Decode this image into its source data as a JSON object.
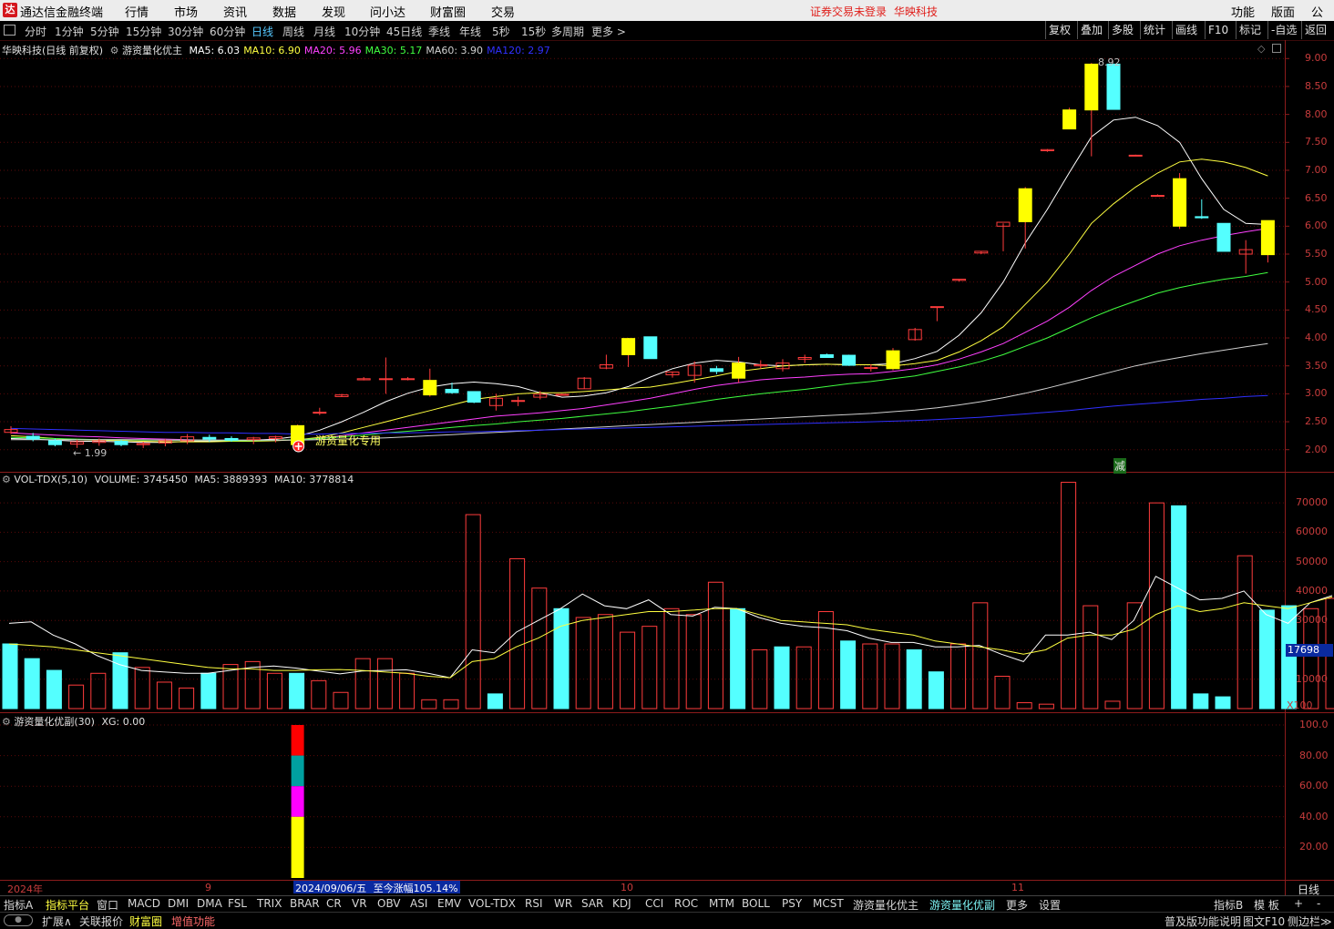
{
  "titlebar": {
    "logo": "达",
    "app_title": "通达信金融终端",
    "menu": [
      "行情",
      "市场",
      "资讯",
      "数据",
      "发现",
      "问小达",
      "财富圈",
      "交易"
    ],
    "login_warning": "证券交易未登录",
    "stock_name": "华映科技",
    "right_menu": [
      "功能",
      "版面",
      "公式"
    ]
  },
  "toolbar": {
    "periods": [
      "分时",
      "1分钟",
      "5分钟",
      "15分钟",
      "30分钟",
      "60分钟",
      "日线",
      "周线",
      "月线",
      "10分钟",
      "45日线",
      "季线",
      "年线",
      "5秒",
      "15秒",
      "多周期",
      "更多 >"
    ],
    "active_period": "日线",
    "right_buttons": [
      "复权",
      "叠加",
      "多股",
      "统计",
      "画线",
      "F10",
      "标记",
      "-自选",
      "返回"
    ]
  },
  "main_pane": {
    "stock_label": "华映科技(日线 前复权)",
    "indicator": "游资量化优主",
    "ma": [
      {
        "label": "MA5: 6.03",
        "color": "#ffffff"
      },
      {
        "label": "MA10: 6.90",
        "color": "#ffff40"
      },
      {
        "label": "MA20: 5.96",
        "color": "#ff40ff"
      },
      {
        "label": "MA30: 5.17",
        "color": "#40ff40"
      },
      {
        "label": "MA60: 3.90",
        "color": "#d0d0d0"
      },
      {
        "label": "MA120: 2.97",
        "color": "#3030ff"
      }
    ],
    "y_labels": [
      "9.00",
      "8.50",
      "8.00",
      "7.50",
      "7.00",
      "6.50",
      "6.00",
      "5.50",
      "5.00",
      "4.50",
      "4.00",
      "3.50",
      "3.00",
      "2.50",
      "2.00"
    ],
    "low_marker": "← 1.99",
    "high_marker": "8.92",
    "signal_text": "游资量化专用",
    "reduce_text": "减"
  },
  "vol_pane": {
    "header": "VOL-TDX(5,10)",
    "volume": "VOLUME: 3745450",
    "ma5": "MA5: 3889393",
    "ma10": "MA10: 3778814",
    "y_labels": [
      "70000",
      "60000",
      "50000",
      "40000",
      "30000",
      "20000",
      "10000"
    ],
    "cursor_value": "17698",
    "multiplier": "X100"
  },
  "ind_pane": {
    "header": "游资量化优副(30)",
    "xg": "XG: 0.00",
    "y_labels": [
      "100.0",
      "80.00",
      "60.00",
      "40.00",
      "20.00"
    ]
  },
  "axis": {
    "labels": [
      "2024年",
      "9",
      "10",
      "11"
    ],
    "cursor_date": "2024/09/06/五",
    "cursor_gain": "至今涨幅105.14%",
    "period_label": "日线"
  },
  "bottom_tabs": [
    "指标A",
    "指标平台",
    "窗口",
    "MACD",
    "DMI",
    "DMA",
    "FSL",
    "TRIX",
    "BRAR",
    "CR",
    "VR",
    "OBV",
    "ASI",
    "EMV",
    "VOL-TDX",
    "RSI",
    "WR",
    "SAR",
    "KDJ",
    "CCI",
    "ROC",
    "MTM",
    "BOLL",
    "PSY",
    "MCST",
    "游资量化优主",
    "游资量化优副",
    "更多",
    "设置"
  ],
  "bottom_right": [
    "指标B",
    "模 板",
    "+",
    "-"
  ],
  "status": {
    "left": [
      "扩展∧",
      "关联报价",
      "财富圈",
      "增值功能"
    ],
    "right": [
      "普及版功能说明",
      "图文F10",
      "侧边栏≫"
    ]
  },
  "colors": {
    "up": "#ff3c3c",
    "up_fill": "#ffff00",
    "down": "#54ffff",
    "axis": "#8c1c1c"
  },
  "chart_data": [
    {
      "type": "candlestick",
      "title": "华映科技(日线 前复权)",
      "ylim": [
        1.8,
        9.2
      ],
      "candles": [
        [
          2.31,
          2.42,
          2.28,
          2.36
        ],
        [
          2.24,
          2.3,
          2.15,
          2.19
        ],
        [
          2.16,
          2.2,
          2.06,
          2.09
        ],
        [
          2.1,
          2.18,
          2.03,
          2.14
        ],
        [
          2.13,
          2.2,
          2.07,
          2.16
        ],
        [
          2.15,
          2.18,
          2.06,
          2.09
        ],
        [
          2.09,
          2.14,
          2.03,
          2.11
        ],
        [
          2.12,
          2.19,
          2.06,
          2.16
        ],
        [
          2.16,
          2.28,
          2.1,
          2.23
        ],
        [
          2.22,
          2.27,
          2.14,
          2.19
        ],
        [
          2.2,
          2.24,
          2.14,
          2.17
        ],
        [
          2.18,
          2.23,
          2.1,
          2.21
        ],
        [
          2.2,
          2.25,
          2.13,
          2.23
        ],
        [
          2.09,
          2.45,
          2.06,
          2.43
        ],
        [
          2.67,
          2.75,
          2.62,
          2.67
        ],
        [
          2.95,
          3.0,
          2.94,
          2.98
        ],
        [
          3.25,
          3.3,
          3.24,
          3.27
        ],
        [
          3.27,
          3.65,
          3.0,
          3.27
        ],
        [
          3.27,
          3.3,
          3.24,
          3.27
        ],
        [
          2.98,
          3.45,
          2.95,
          3.24
        ],
        [
          3.08,
          3.2,
          3.0,
          3.02
        ],
        [
          3.04,
          2.84,
          2.83,
          2.85
        ],
        [
          2.79,
          3.0,
          2.7,
          2.92
        ],
        [
          2.87,
          2.95,
          2.78,
          2.88
        ],
        [
          2.94,
          3.05,
          2.9,
          2.99
        ],
        [
          2.98,
          3.0,
          2.97,
          2.99
        ],
        [
          3.09,
          3.3,
          3.09,
          3.28
        ],
        [
          3.46,
          3.7,
          3.44,
          3.52
        ],
        [
          3.7,
          4.0,
          3.48,
          3.99
        ],
        [
          4.02,
          4.02,
          3.63,
          3.63
        ],
        [
          3.34,
          3.4,
          3.29,
          3.39
        ],
        [
          3.33,
          3.58,
          3.2,
          3.51
        ],
        [
          3.45,
          3.5,
          3.35,
          3.4
        ],
        [
          3.28,
          3.66,
          3.2,
          3.55
        ],
        [
          3.5,
          3.6,
          3.45,
          3.52
        ],
        [
          3.45,
          3.62,
          3.4,
          3.55
        ],
        [
          3.62,
          3.7,
          3.55,
          3.65
        ],
        [
          3.7,
          3.72,
          3.65,
          3.65
        ],
        [
          3.69,
          3.7,
          3.5,
          3.51
        ],
        [
          3.47,
          3.53,
          3.4,
          3.47
        ],
        [
          3.45,
          3.82,
          3.42,
          3.77
        ],
        [
          3.97,
          4.18,
          3.95,
          4.15
        ],
        [
          4.55,
          4.55,
          4.3,
          4.56
        ],
        [
          5.03,
          5.05,
          5.01,
          5.05
        ],
        [
          5.52,
          5.55,
          5.5,
          5.55
        ],
        [
          6.0,
          6.05,
          5.55,
          6.07
        ],
        [
          6.08,
          6.7,
          5.6,
          6.67
        ],
        [
          7.35,
          7.38,
          7.33,
          7.37
        ],
        [
          7.74,
          8.12,
          7.74,
          8.08
        ],
        [
          8.08,
          8.92,
          7.25,
          8.9
        ],
        [
          8.9,
          8.9,
          8.09,
          8.09
        ],
        [
          7.27,
          7.28,
          7.26,
          7.27
        ],
        [
          6.55,
          6.57,
          6.53,
          6.55
        ],
        [
          6.0,
          6.95,
          5.95,
          6.85
        ],
        [
          6.17,
          6.48,
          6.13,
          6.15
        ],
        [
          6.05,
          6.05,
          5.55,
          5.55
        ],
        [
          5.5,
          5.75,
          5.15,
          5.58
        ],
        [
          5.49,
          6.1,
          5.35,
          6.1
        ]
      ],
      "ma_series": [
        {
          "name": "MA5",
          "values": [
            2.2,
            2.19,
            2.17,
            2.15,
            2.15,
            2.14,
            2.13,
            2.13,
            2.15,
            2.15,
            2.16,
            2.17,
            2.19,
            2.24,
            2.35,
            2.5,
            2.67,
            2.86,
            3.01,
            3.12,
            3.18,
            3.21,
            3.18,
            3.13,
            3.02,
            2.94,
            2.96,
            3.02,
            3.13,
            3.3,
            3.45,
            3.55,
            3.6,
            3.57,
            3.52,
            3.5,
            3.52,
            3.53,
            3.52,
            3.52,
            3.54,
            3.63,
            3.76,
            4.05,
            4.45,
            5.0,
            5.7,
            6.3,
            6.96,
            7.6,
            7.9,
            7.95,
            7.8,
            7.5,
            6.85,
            6.3,
            6.05,
            6.03
          ]
        },
        {
          "name": "MA10",
          "values": [
            2.25,
            2.23,
            2.2,
            2.18,
            2.17,
            2.16,
            2.15,
            2.14,
            2.14,
            2.14,
            2.15,
            2.15,
            2.16,
            2.18,
            2.22,
            2.3,
            2.4,
            2.5,
            2.6,
            2.7,
            2.8,
            2.9,
            2.95,
            3.0,
            3.02,
            3.02,
            3.04,
            3.07,
            3.1,
            3.12,
            3.18,
            3.25,
            3.32,
            3.4,
            3.45,
            3.5,
            3.52,
            3.53,
            3.52,
            3.52,
            3.5,
            3.54,
            3.6,
            3.75,
            3.95,
            4.2,
            4.6,
            5.0,
            5.5,
            6.05,
            6.4,
            6.7,
            6.95,
            7.15,
            7.2,
            7.15,
            7.05,
            6.9
          ]
        },
        {
          "name": "MA20",
          "values": [
            2.3,
            2.28,
            2.26,
            2.24,
            2.23,
            2.21,
            2.2,
            2.19,
            2.18,
            2.17,
            2.17,
            2.17,
            2.17,
            2.18,
            2.2,
            2.25,
            2.3,
            2.35,
            2.4,
            2.45,
            2.5,
            2.55,
            2.6,
            2.63,
            2.66,
            2.7,
            2.74,
            2.8,
            2.86,
            2.92,
            3.0,
            3.08,
            3.15,
            3.2,
            3.25,
            3.28,
            3.3,
            3.33,
            3.35,
            3.36,
            3.4,
            3.45,
            3.52,
            3.62,
            3.75,
            3.9,
            4.1,
            4.3,
            4.55,
            4.85,
            5.1,
            5.3,
            5.5,
            5.65,
            5.75,
            5.83,
            5.9,
            5.96
          ]
        },
        {
          "name": "MA30",
          "values": [
            2.22,
            2.21,
            2.2,
            2.19,
            2.18,
            2.18,
            2.17,
            2.17,
            2.17,
            2.17,
            2.16,
            2.16,
            2.17,
            2.18,
            2.2,
            2.23,
            2.26,
            2.3,
            2.33,
            2.36,
            2.4,
            2.43,
            2.46,
            2.5,
            2.53,
            2.56,
            2.6,
            2.64,
            2.68,
            2.73,
            2.78,
            2.84,
            2.9,
            2.95,
            3.0,
            3.04,
            3.08,
            3.13,
            3.18,
            3.22,
            3.27,
            3.32,
            3.4,
            3.48,
            3.58,
            3.7,
            3.85,
            4.0,
            4.18,
            4.36,
            4.52,
            4.66,
            4.8,
            4.9,
            4.98,
            5.05,
            5.1,
            5.17
          ]
        },
        {
          "name": "MA60",
          "values": [
            2.18,
            2.18,
            2.18,
            2.18,
            2.18,
            2.18,
            2.18,
            2.17,
            2.17,
            2.17,
            2.17,
            2.17,
            2.17,
            2.17,
            2.18,
            2.19,
            2.2,
            2.21,
            2.23,
            2.25,
            2.27,
            2.29,
            2.31,
            2.33,
            2.35,
            2.37,
            2.39,
            2.41,
            2.43,
            2.45,
            2.47,
            2.49,
            2.51,
            2.53,
            2.55,
            2.57,
            2.59,
            2.61,
            2.63,
            2.65,
            2.68,
            2.71,
            2.75,
            2.8,
            2.86,
            2.93,
            3.01,
            3.1,
            3.2,
            3.3,
            3.4,
            3.5,
            3.58,
            3.65,
            3.72,
            3.78,
            3.84,
            3.9
          ]
        },
        {
          "name": "MA120",
          "values": [
            2.38,
            2.37,
            2.36,
            2.35,
            2.34,
            2.33,
            2.32,
            2.31,
            2.31,
            2.3,
            2.3,
            2.29,
            2.29,
            2.28,
            2.28,
            2.29,
            2.29,
            2.3,
            2.3,
            2.31,
            2.32,
            2.32,
            2.33,
            2.34,
            2.35,
            2.36,
            2.37,
            2.38,
            2.39,
            2.4,
            2.41,
            2.42,
            2.43,
            2.44,
            2.45,
            2.46,
            2.47,
            2.48,
            2.49,
            2.5,
            2.51,
            2.52,
            2.54,
            2.56,
            2.58,
            2.61,
            2.64,
            2.67,
            2.7,
            2.74,
            2.78,
            2.81,
            2.84,
            2.87,
            2.9,
            2.92,
            2.95,
            2.97
          ]
        }
      ]
    },
    {
      "type": "bar",
      "title": "VOL-TDX(5,10)",
      "ylim": [
        0,
        75000
      ],
      "values": [
        22000,
        17000,
        13000,
        8000,
        12000,
        19000,
        14000,
        9000,
        7000,
        12000,
        15000,
        16000,
        12000,
        12000,
        9500,
        5500,
        17000,
        17000,
        12000,
        3000,
        3000,
        66000,
        5000,
        51000,
        41000,
        34000,
        31000,
        32000,
        26000,
        28000,
        34000,
        32000,
        43000,
        34000,
        20000,
        21000,
        21000,
        33000,
        23000,
        22000,
        22000,
        20000,
        12500,
        22000,
        36000,
        11000,
        2000,
        1500,
        77000,
        35000,
        2500,
        36000,
        70000,
        69000,
        5000,
        4000,
        52000,
        33500,
        35000,
        34000,
        37500
      ],
      "down_flags": [
        1,
        1,
        1,
        0,
        0,
        1,
        0,
        0,
        0,
        1,
        0,
        0,
        0,
        1,
        0,
        0,
        0,
        0,
        0,
        0,
        0,
        0,
        1,
        0,
        0,
        1,
        0,
        0,
        0,
        0,
        0,
        0,
        0,
        1,
        0,
        1,
        0,
        0,
        1,
        0,
        0,
        1,
        1,
        0,
        0,
        0,
        0,
        0,
        0,
        0,
        0,
        0,
        0,
        1,
        1,
        1,
        0,
        1,
        1,
        0,
        0
      ],
      "ma5": [
        29000,
        29500,
        25000,
        22000,
        18000,
        15000,
        13000,
        12500,
        12000,
        12000,
        13000,
        14000,
        14500,
        13800,
        12800,
        11800,
        12800,
        13000,
        13200,
        12000,
        10500,
        20000,
        19000,
        26000,
        30000,
        34000,
        39000,
        35000,
        34000,
        37000,
        32000,
        31500,
        34500,
        34000,
        31000,
        29000,
        28000,
        27500,
        26500,
        24000,
        22500,
        22500,
        21000,
        21000,
        21500,
        18500,
        16000,
        25000,
        25000,
        26000,
        23500,
        30000,
        45000,
        41000,
        37000,
        37500,
        40000,
        32000,
        29000,
        36000,
        38500
      ],
      "ma10": [
        22000,
        21500,
        21000,
        20000,
        19000,
        18000,
        17000,
        16000,
        15000,
        14000,
        13500,
        13500,
        13000,
        13000,
        13200,
        13300,
        13000,
        12500,
        12000,
        11000,
        10500,
        16000,
        17000,
        21000,
        24000,
        28000,
        30000,
        31000,
        32000,
        33000,
        33000,
        33500,
        34000,
        34000,
        32000,
        30000,
        29500,
        29000,
        28500,
        27000,
        26000,
        25000,
        23000,
        22000,
        21000,
        20000,
        18500,
        20000,
        24000,
        25000,
        25000,
        27000,
        32000,
        35000,
        33000,
        34000,
        36000,
        35000,
        34000,
        36000,
        38000
      ]
    },
    {
      "type": "bar",
      "title": "游资量化优副(30)",
      "ylim": [
        0,
        100
      ],
      "signal_day": 13,
      "segments": [
        {
          "color": "#ff0000",
          "value": 100
        },
        {
          "color": "#00a0a0",
          "value": 80
        },
        {
          "color": "#ff00ff",
          "value": 60
        },
        {
          "color": "#ffff00",
          "value": 40
        }
      ]
    }
  ]
}
